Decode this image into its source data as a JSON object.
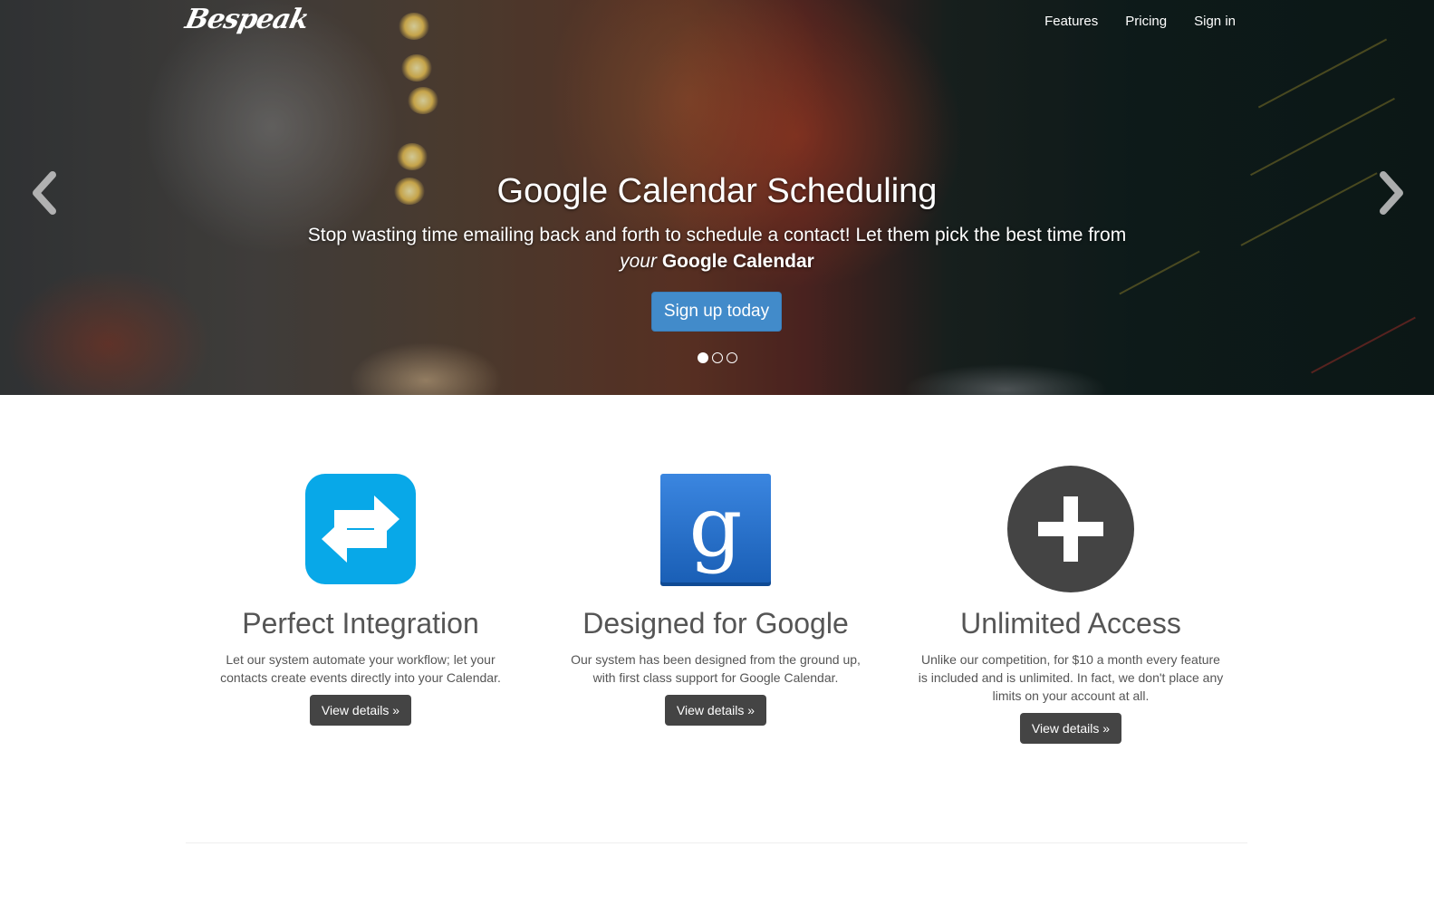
{
  "navbar": {
    "brand": "Bespeak",
    "links": [
      "Features",
      "Pricing",
      "Sign in"
    ]
  },
  "carousel": {
    "title": "Google Calendar Scheduling",
    "text_line1": "Stop wasting time emailing back and forth to schedule a contact! Let them pick the best time from",
    "text_em": "your",
    "text_strong": "Google Calendar",
    "cta_label": "Sign up today",
    "slide_count": 3,
    "active_slide": 1,
    "prev_icon": "chevron-left-icon",
    "next_icon": "chevron-right-icon"
  },
  "features": [
    {
      "icon": "swap-arrows-icon",
      "icon_color": "#08a8e8",
      "title": "Perfect Integration",
      "text": "Let our system automate your workflow; let your contacts create events directly into your Calendar.",
      "button": "View details »"
    },
    {
      "icon": "google-g-icon",
      "icon_color": "#1f6cc8",
      "title": "Designed for Google",
      "text": "Our system has been designed from the ground up, with first class support for Google Calendar.",
      "button": "View details »"
    },
    {
      "icon": "plus-circle-icon",
      "icon_color": "#444444",
      "title": "Unlimited Access",
      "text": "Unlike our competition, for $10 a month every feature is included and is unlimited. In fact, we don't place any limits on your account at all.",
      "button": "View details »"
    }
  ],
  "colors": {
    "primary": "#428bca",
    "dark_button": "#444444",
    "text": "#555555"
  }
}
